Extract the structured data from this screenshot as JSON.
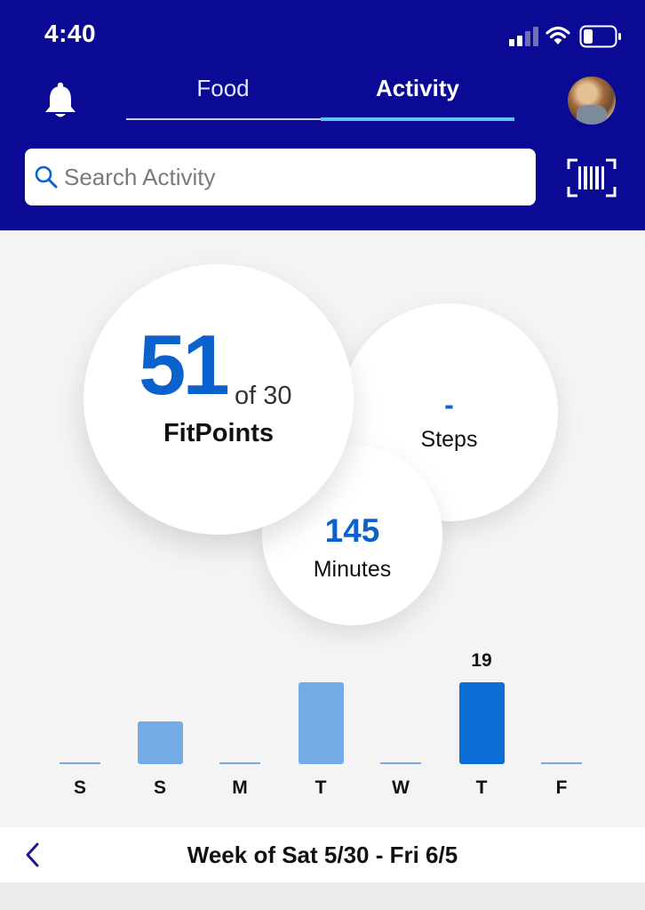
{
  "status": {
    "time": "4:40"
  },
  "tabs": [
    {
      "label": "Food",
      "active": false
    },
    {
      "label": "Activity",
      "active": true
    }
  ],
  "search": {
    "placeholder": "Search Activity",
    "value": ""
  },
  "summary": {
    "fitpoints": {
      "value": "51",
      "goal": "of 30",
      "label": "FitPoints"
    },
    "steps": {
      "value": "-",
      "label": "Steps"
    },
    "minutes": {
      "value": "145",
      "label": "Minutes"
    }
  },
  "chart_data": {
    "type": "bar",
    "categories": [
      "S",
      "S",
      "M",
      "T",
      "W",
      "T",
      "F"
    ],
    "values": [
      0,
      10,
      0,
      19,
      0,
      19,
      0
    ],
    "selected_index": 5,
    "data_labels": [
      {
        "index": 5,
        "text": "19"
      }
    ],
    "colors": {
      "bar": "#72abe5",
      "selected": "#0c6dd4",
      "baseline": "#7aa9e0"
    }
  },
  "week": {
    "label": "Week of Sat 5/30 - Fri 6/5"
  },
  "colors": {
    "brand": "#0a0a94",
    "accent": "#5ec2ff",
    "value_blue": "#0c62cc"
  },
  "icons": [
    "bell-icon",
    "search-icon",
    "barcode-icon",
    "chevron-left-icon",
    "signal-icon",
    "wifi-icon",
    "battery-icon"
  ]
}
